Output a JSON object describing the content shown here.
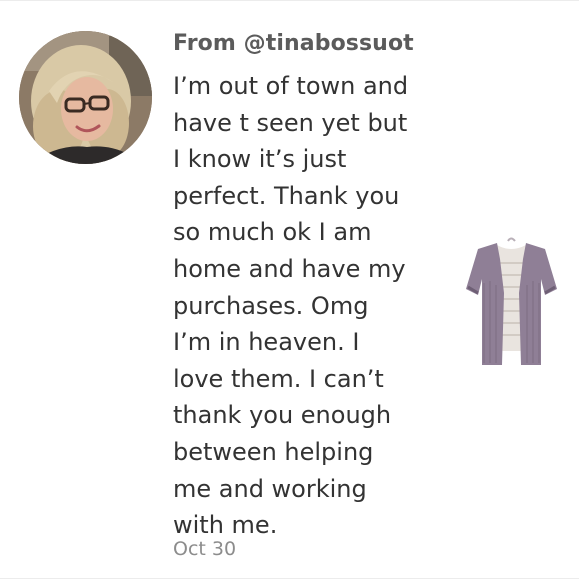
{
  "comment": {
    "sender": "From @tinabossuot",
    "message_lines": [
      "I’m out of town and",
      "have t seen yet but",
      "I know it’s just",
      "perfect. Thank you",
      "so much ok I am",
      "home and have my",
      "purchases. Omg",
      "I’m in heaven. I",
      "love them. I can’t",
      "thank you enough",
      "between helping",
      "me and working",
      "with me."
    ],
    "date": "Oct 30"
  },
  "avatar": {
    "icon": "user-photo"
  },
  "product": {
    "icon": "cardigan-thumbnail",
    "colors": {
      "cardigan": "#8f7f96",
      "cardigan_shadow": "#6e5f75",
      "tee": "#e9e4df"
    }
  },
  "colors": {
    "sender_text": "#5b5b5b",
    "message_text": "#333333",
    "date_text": "#8c8c8c",
    "divider": "#ececec"
  }
}
